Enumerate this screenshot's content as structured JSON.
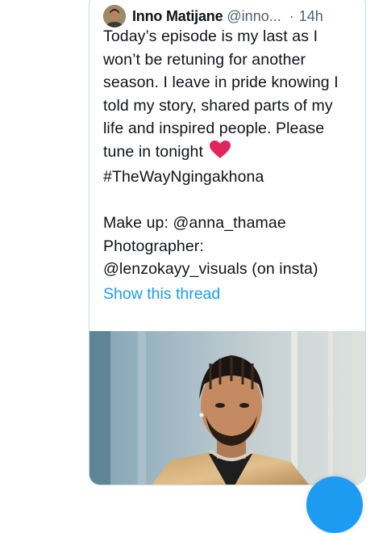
{
  "tweet": {
    "author_name": "Inno Matijane",
    "handle": "@inno...",
    "separator": "·",
    "time": "14h",
    "lines": [
      "Today’s episode is my last as I",
      "won’t be retuning for another",
      "season. I leave in pride knowing I",
      "told my story, shared parts of my",
      "life and inspired people. Please",
      "tune in tonight"
    ],
    "hashtag": "#TheWayNgingakhona",
    "credits": [
      "Make up: @anna_thamae",
      "Photographer:",
      "@lenzokayy_visuals (on insta)"
    ],
    "show_thread": "Show this thread"
  },
  "colors": {
    "link": "#1d9bf0",
    "heart": "#e0245e",
    "muted": "#536471",
    "border": "#cfd9de"
  },
  "icons": {
    "heart": "red-heart-emoji",
    "avatar": "profile-avatar"
  }
}
